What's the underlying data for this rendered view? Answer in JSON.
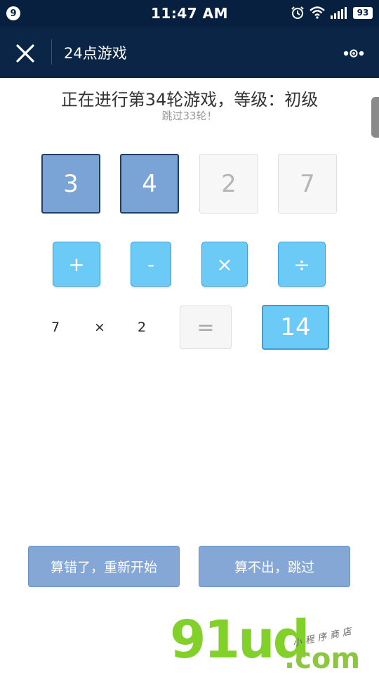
{
  "status_bar": {
    "badge": "9",
    "time": "11:47 AM",
    "battery": "93",
    "icons": [
      "alarm-icon",
      "wifi-icon",
      "signal-icon",
      "battery-icon"
    ]
  },
  "nav": {
    "title": "24点游戏",
    "close_icon": "close-icon",
    "more_icon": "more-icon"
  },
  "game": {
    "title": "正在进行第34轮游戏，等级：初级",
    "subtitle": "跳过33轮！",
    "numbers": [
      "3",
      "4",
      "2",
      "7"
    ],
    "operators": [
      "+",
      "-",
      "×",
      "÷"
    ],
    "expression": {
      "left": "7",
      "operator": "×",
      "right": "2",
      "equals": "=",
      "result": "14"
    }
  },
  "actions": {
    "restart": "算错了，重新开始",
    "skip": "算不出，跳过"
  },
  "watermark": {
    "logo": "91ud",
    "domain": ".com",
    "tagline": "小程序商店"
  },
  "colors": {
    "header_bg": "#0a2545",
    "card_active": "#7aa3d6",
    "operator": "#6ccaf7",
    "action": "#84a7d6",
    "watermark_green": "#82d12a"
  }
}
